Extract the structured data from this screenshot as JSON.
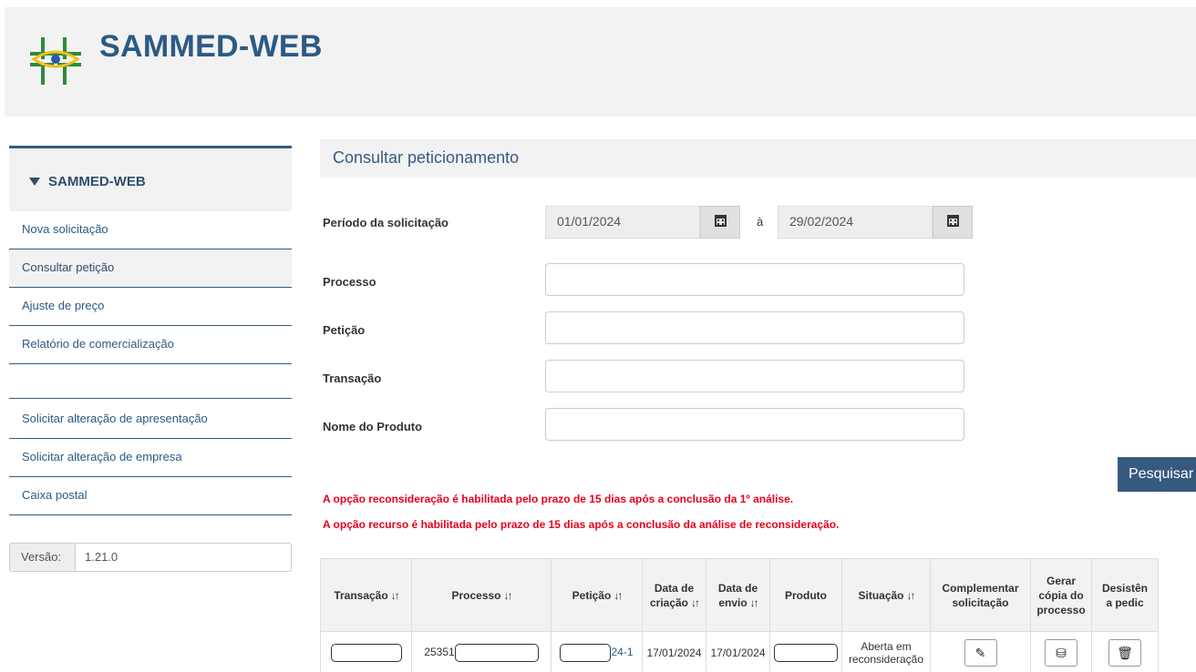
{
  "header": {
    "title": "SAMMED-WEB"
  },
  "colors": {
    "brand_blue": "#2b5a84",
    "nav_border": "#375a7f",
    "warning_red": "#e8001c",
    "header_bg": "#f2f2f2"
  },
  "sidebar": {
    "heading": "SAMMED-WEB",
    "items": [
      {
        "label": "Nova solicitação"
      },
      {
        "label": "Consultar petição"
      },
      {
        "label": "Ajuste de preço"
      },
      {
        "label": "Relatório de comercialização"
      },
      {
        "label": "Solicitar alteração de apresentação"
      },
      {
        "label": "Solicitar alteração de empresa"
      },
      {
        "label": "Caixa postal"
      }
    ],
    "version_label": "Versão:",
    "version_value": "1.21.0"
  },
  "main": {
    "section_title": "Consultar peticionamento",
    "period_label": "Período da solicitação",
    "date_from": "01/01/2024",
    "date_to": "29/02/2024",
    "date_separator": "à",
    "fields": [
      {
        "label": "Processo",
        "value": ""
      },
      {
        "label": "Petição",
        "value": ""
      },
      {
        "label": "Transação",
        "value": ""
      },
      {
        "label": "Nome do Produto",
        "value": ""
      }
    ],
    "search_button": "Pesquisar",
    "notices": [
      "A opção reconsideração é habilitada pelo prazo de 15 dias após a conclusão da 1º análise.",
      "A opção recurso é habilitada pelo prazo de 15 dias após a conclusão da análise de reconsideração."
    ]
  },
  "table": {
    "headers": {
      "transacao": "Transação",
      "processo": "Processo",
      "peticao": "Petição",
      "data_criacao_1": "Data de",
      "data_criacao_2": "criação",
      "data_envio_1": "Data de",
      "data_envio_2": "envio",
      "produto": "Produto",
      "situacao": "Situação",
      "complementar_1": "Complementar",
      "complementar_2": "solicitação",
      "gerar_1": "Gerar",
      "gerar_2": "cópia do",
      "gerar_3": "processo",
      "desist_1": "Desistên",
      "desist_2": "a pedic"
    },
    "sort_icon": "sort-icon",
    "rows": [
      {
        "processo_prefix": "25351",
        "peticao_suffix": "24-1",
        "data_criacao": "17/01/2024",
        "data_envio": "17/01/2024",
        "situacao_1": "Aberta em",
        "situacao_2": "reconsideração"
      }
    ]
  },
  "icons": [
    "calendar-icon",
    "pencil-icon",
    "copy-stamp-icon",
    "trash-icon",
    "caret-down-icon",
    "logo-icon"
  ]
}
